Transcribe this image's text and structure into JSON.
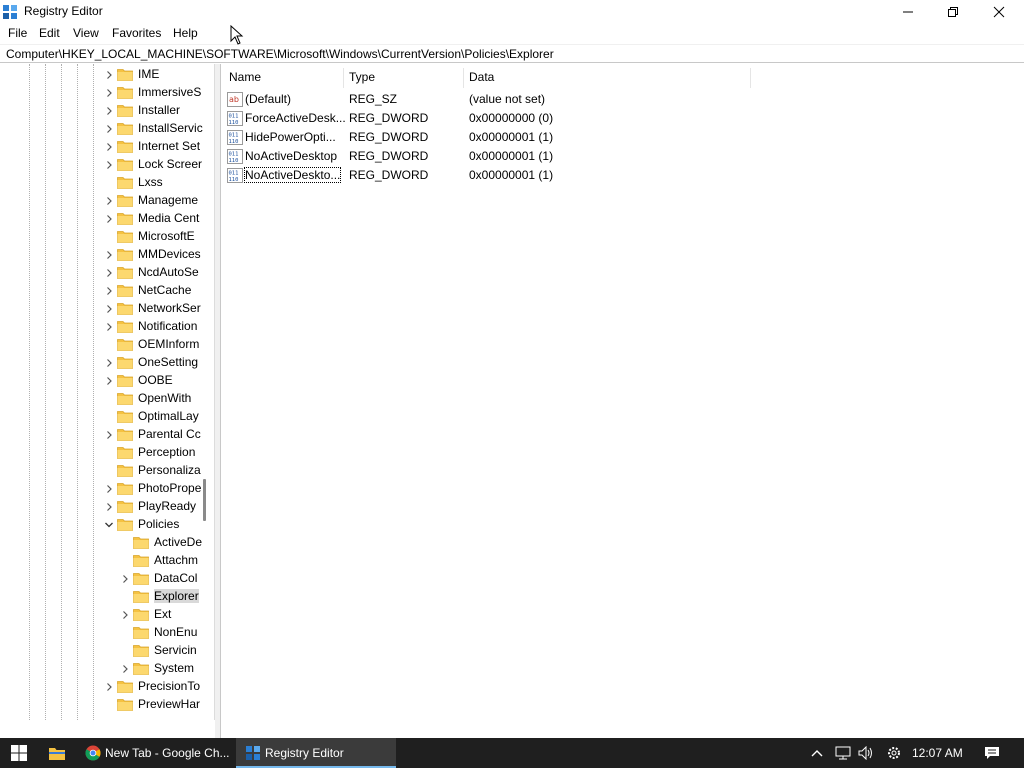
{
  "window": {
    "title": "Registry Editor",
    "icon": "registry-editor-icon",
    "controls": [
      "minimize-icon",
      "maximize-icon",
      "close-icon"
    ]
  },
  "menu": {
    "file": "File",
    "edit": "Edit",
    "view": "View",
    "favorites": "Favorites",
    "help": "Help"
  },
  "address": "Computer\\HKEY_LOCAL_MACHINE\\SOFTWARE\\Microsoft\\Windows\\CurrentVersion\\Policies\\Explorer",
  "tree": {
    "items": [
      {
        "label": "IME",
        "expandable": true
      },
      {
        "label": "ImmersiveS",
        "expandable": true
      },
      {
        "label": "Installer",
        "expandable": true
      },
      {
        "label": "InstallServic",
        "expandable": true
      },
      {
        "label": "Internet Set",
        "expandable": true
      },
      {
        "label": "Lock Screer",
        "expandable": true
      },
      {
        "label": "Lxss",
        "expandable": false
      },
      {
        "label": "Manageme",
        "expandable": true
      },
      {
        "label": "Media Cent",
        "expandable": true
      },
      {
        "label": "MicrosoftE",
        "expandable": false
      },
      {
        "label": "MMDevices",
        "expandable": true
      },
      {
        "label": "NcdAutoSe",
        "expandable": true
      },
      {
        "label": "NetCache",
        "expandable": true
      },
      {
        "label": "NetworkSer",
        "expandable": true
      },
      {
        "label": "Notification",
        "expandable": true
      },
      {
        "label": "OEMInform",
        "expandable": false
      },
      {
        "label": "OneSetting",
        "expandable": true
      },
      {
        "label": "OOBE",
        "expandable": true
      },
      {
        "label": "OpenWith",
        "expandable": false
      },
      {
        "label": "OptimalLay",
        "expandable": false
      },
      {
        "label": "Parental Cc",
        "expandable": true
      },
      {
        "label": "Perception",
        "expandable": false
      },
      {
        "label": "Personaliza",
        "expandable": false
      },
      {
        "label": "PhotoPrope",
        "expandable": true
      },
      {
        "label": "PlayReady",
        "expandable": true
      },
      {
        "label": "Policies",
        "expandable": true,
        "expanded": true
      },
      {
        "label": "ActiveDe",
        "expandable": false,
        "child": true
      },
      {
        "label": "Attachm",
        "expandable": false,
        "child": true
      },
      {
        "label": "DataCol",
        "expandable": true,
        "child": true
      },
      {
        "label": "Explorer",
        "expandable": false,
        "child": true,
        "selected": true
      },
      {
        "label": "Ext",
        "expandable": true,
        "child": true
      },
      {
        "label": "NonEnu",
        "expandable": false,
        "child": true
      },
      {
        "label": "Servicin",
        "expandable": false,
        "child": true
      },
      {
        "label": "System",
        "expandable": true,
        "child": true
      },
      {
        "label": "PrecisionTo",
        "expandable": true
      },
      {
        "label": "PreviewHar",
        "expandable": false
      }
    ]
  },
  "values": {
    "headers": {
      "name": "Name",
      "type": "Type",
      "data": "Data"
    },
    "rows": [
      {
        "name": "(Default)",
        "type": "REG_SZ",
        "data": "(value not set)",
        "icon": "string-value-icon"
      },
      {
        "name": "ForceActiveDesk...",
        "type": "REG_DWORD",
        "data": "0x00000000 (0)",
        "icon": "binary-value-icon"
      },
      {
        "name": "HidePowerOpti...",
        "type": "REG_DWORD",
        "data": "0x00000001 (1)",
        "icon": "binary-value-icon"
      },
      {
        "name": "NoActiveDesktop",
        "type": "REG_DWORD",
        "data": "0x00000001 (1)",
        "icon": "binary-value-icon"
      },
      {
        "name": "NoActiveDeskto...",
        "type": "REG_DWORD",
        "data": "0x00000001 (1)",
        "icon": "binary-value-icon",
        "focused": true
      }
    ]
  },
  "taskbar": {
    "chrome": "New Tab - Google Ch...",
    "regedit": "Registry Editor",
    "clock": "12:07 AM"
  },
  "colors": {
    "folder": "#f5c242",
    "taskbar": "#1f1f1f",
    "active_task_underline": "#76b9ed",
    "selection": "#d9d9d9"
  }
}
